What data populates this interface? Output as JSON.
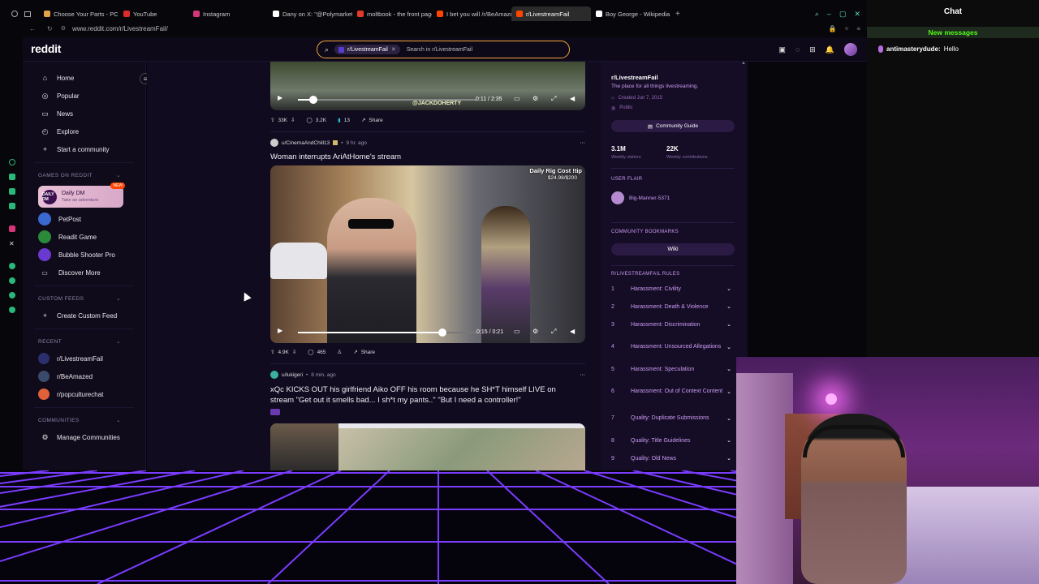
{
  "browser": {
    "tabs": [
      {
        "label": "Choose Your Parts - PCPa",
        "color": "#e2a34a"
      },
      {
        "label": "YouTube",
        "color": "#e02b2b"
      },
      {
        "label": "Instagram",
        "color": "#d6357a"
      },
      {
        "label": "Dany on X: \"@Polymarket",
        "color": "#ffffff"
      },
      {
        "label": "moltbook - the front page",
        "color": "#e23a2a"
      },
      {
        "label": "I bet you will /r/BeAmaze",
        "color": "#ff4500"
      },
      {
        "label": "r/LivestreamFail",
        "color": "#ff4500"
      },
      {
        "label": "Boy George - Wikipedia",
        "color": "#ffffff"
      }
    ],
    "url": "www.reddit.com/r/LivestreamFail/"
  },
  "reddit": {
    "logo": "reddit",
    "search_chip": "r/LivestreamFail",
    "search_placeholder": "Search in r/LivestreamFail"
  },
  "sidebar": {
    "nav": [
      {
        "label": "Home",
        "icon": "home-icon",
        "glyph": "⌂"
      },
      {
        "label": "Popular",
        "icon": "popular-icon",
        "glyph": "◎"
      },
      {
        "label": "News",
        "icon": "news-icon",
        "glyph": "▭"
      },
      {
        "label": "Explore",
        "icon": "explore-icon",
        "glyph": "◴"
      },
      {
        "label": "Start a community",
        "icon": "plus-icon",
        "glyph": "+"
      }
    ],
    "games_header": "GAMES ON REDDIT",
    "daily_dm": {
      "title": "Daily DM",
      "subtitle": "Take an adventure",
      "badge": "NEW"
    },
    "games": [
      {
        "label": "PetPost"
      },
      {
        "label": "Readit Game"
      },
      {
        "label": "Bubble Shooter Pro"
      },
      {
        "label": "Discover More"
      }
    ],
    "custom_feeds_header": "CUSTOM FEEDS",
    "create_feed": "Create Custom Feed",
    "recent_header": "RECENT",
    "recent": [
      {
        "label": "r/LivestreamFail",
        "color": "#2b2f6b"
      },
      {
        "label": "r/BeAmazed",
        "color": "#3a4a6a"
      },
      {
        "label": "r/popculturechat",
        "color": "#e0603a"
      }
    ],
    "communities_header": "COMMUNITIES",
    "manage": "Manage Communities"
  },
  "feed": {
    "post1": {
      "video_time": "0:11 / 2:35",
      "watermark": "@JACKDOHERTY",
      "votes": "33K",
      "comments": "3.2K",
      "awards": "13",
      "share": "Share"
    },
    "post2": {
      "user": "u/CinemaAndChill13",
      "age": "9 hr. ago",
      "title": "Woman interrupts AriAtHome's stream",
      "overlay_title": "Daily Rig Cost !tip",
      "overlay_amount": "$24.98/$200",
      "video_time": "0:15 / 0:21",
      "progress": 0.81,
      "votes": "4.9K",
      "comments": "465",
      "share": "Share"
    },
    "post3": {
      "user": "u/lukigeri",
      "age": "8 min. ago",
      "title": "xQc KICKS OUT his girlfriend Aiko OFF his room because he SH*T himself LIVE on stream \"Get out it smells bad... I sh*t my pants..\" \"But I need a controller!\""
    }
  },
  "right": {
    "name": "r/LivestreamFail",
    "tagline": "The place for all things livestreaming.",
    "created": "Created Jun 7, 2015",
    "public": "Public",
    "guide": "Community Guide",
    "visitors": "3.1M",
    "visitors_label": "Weekly visitors",
    "contribs": "22K",
    "contribs_label": "Weekly contributions",
    "user_flair_header": "USER FLAIR",
    "flair_user": "Big-Manner-5371",
    "bookmarks_header": "COMMUNITY BOOKMARKS",
    "wiki": "Wiki",
    "rules_header": "R/LIVESTREAMFAIL RULES",
    "rules": [
      {
        "n": "1",
        "text": "Harassment: Civility"
      },
      {
        "n": "2",
        "text": "Harassment: Death & Violence"
      },
      {
        "n": "3",
        "text": "Harassment: Discrimination"
      },
      {
        "n": "4",
        "text": "Harassment: Unsourced Allegations"
      },
      {
        "n": "5",
        "text": "Harassment: Speculation"
      },
      {
        "n": "6",
        "text": "Harassment: Out of Context Content"
      },
      {
        "n": "7",
        "text": "Quality: Duplicate Submissions"
      },
      {
        "n": "8",
        "text": "Quality: Title Guidelines"
      },
      {
        "n": "9",
        "text": "Quality: Old News"
      }
    ]
  },
  "chat": {
    "title": "Chat",
    "new_messages": "New messages",
    "messages": [
      {
        "user": "antimasterydude:",
        "text": "Hello"
      }
    ]
  },
  "colors": {
    "accent": "#ff4500",
    "purple": "#cd9bf5",
    "chat_green": "#53fc18"
  }
}
